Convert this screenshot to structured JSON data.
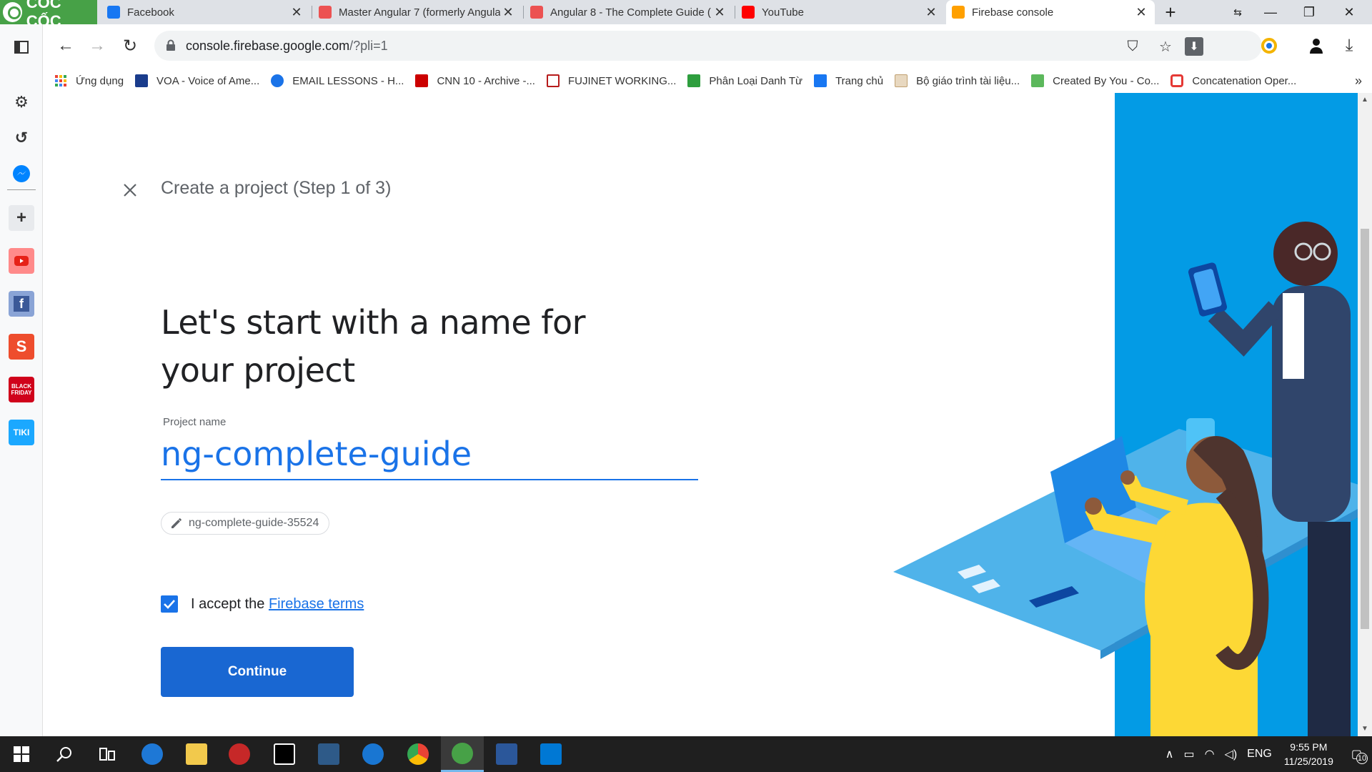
{
  "browser": {
    "brand": "CỐC CỐC",
    "tabs": [
      {
        "title": "Facebook",
        "icon": "facebook-icon",
        "active": false
      },
      {
        "title": "Master Angular 7 (formerly Angula",
        "icon": "udemy-icon",
        "active": false
      },
      {
        "title": "Angular 8 - The Complete Guide (",
        "icon": "udemy-icon",
        "active": false
      },
      {
        "title": "YouTube",
        "icon": "youtube-icon",
        "active": false
      },
      {
        "title": "Firebase console",
        "icon": "firebase-icon",
        "active": true
      }
    ],
    "new_tab": "+",
    "url_host": "console.firebase.google.com",
    "url_path": "/?pli=1"
  },
  "bookmarks": [
    {
      "label": "Ứng dụng",
      "icon": "apps-grid-icon",
      "color": "#ea4335"
    },
    {
      "label": "VOA - Voice of Ame...",
      "icon": "voa-icon",
      "color": "#1a3c8c"
    },
    {
      "label": "EMAIL LESSONS - H...",
      "icon": "email-lessons-icon",
      "color": "#1a73e8"
    },
    {
      "label": "CNN 10 - Archive -...",
      "icon": "cnn-icon",
      "color": "#cc0000"
    },
    {
      "label": "FUJINET WORKING...",
      "icon": "fjn-icon",
      "color": "#b71c1c"
    },
    {
      "label": "Phân Loại Danh Từ",
      "icon": "h-icon",
      "color": "#2e9e3e"
    },
    {
      "label": "Trang chủ",
      "icon": "facebook-icon",
      "color": "#1877f2"
    },
    {
      "label": "Bộ giáo trình tài liệu...",
      "icon": "book-icon",
      "color": "#c0a070"
    },
    {
      "label": "Created By You - Co...",
      "icon": "created-icon",
      "color": "#5cb85c"
    },
    {
      "label": "Concatenation Oper...",
      "icon": "oracle-icon",
      "color": "#e53935"
    }
  ],
  "bookmarks_more": "»",
  "sidebar_colors": {
    "youtube": "#ff4a4a",
    "facebook": "#3b5998",
    "shopee": "#ee4d2d",
    "blackfriday": "#d0021b",
    "tiki": "#1ba8ff"
  },
  "sidebar_labels": {
    "shopee": "S",
    "blackfriday": "BLACK FRIDAY",
    "tiki": "TIKI"
  },
  "firebase": {
    "step_title": "Create a project (Step 1 of 3)",
    "heading": "Let's start with a name for your project",
    "project_name_label": "Project name",
    "project_name_value": "ng-complete-guide",
    "project_id": "ng-complete-guide-35524",
    "accept_text": "I accept the ",
    "accept_link": "Firebase terms",
    "accept_checked": true,
    "continue_label": "Continue",
    "accent": "#1a73e8",
    "button_color": "#1967d2",
    "illustration_bg": "#039be5"
  },
  "taskbar": {
    "language": "ENG",
    "time": "9:55 PM",
    "date": "11/25/2019",
    "notifications": "10"
  }
}
